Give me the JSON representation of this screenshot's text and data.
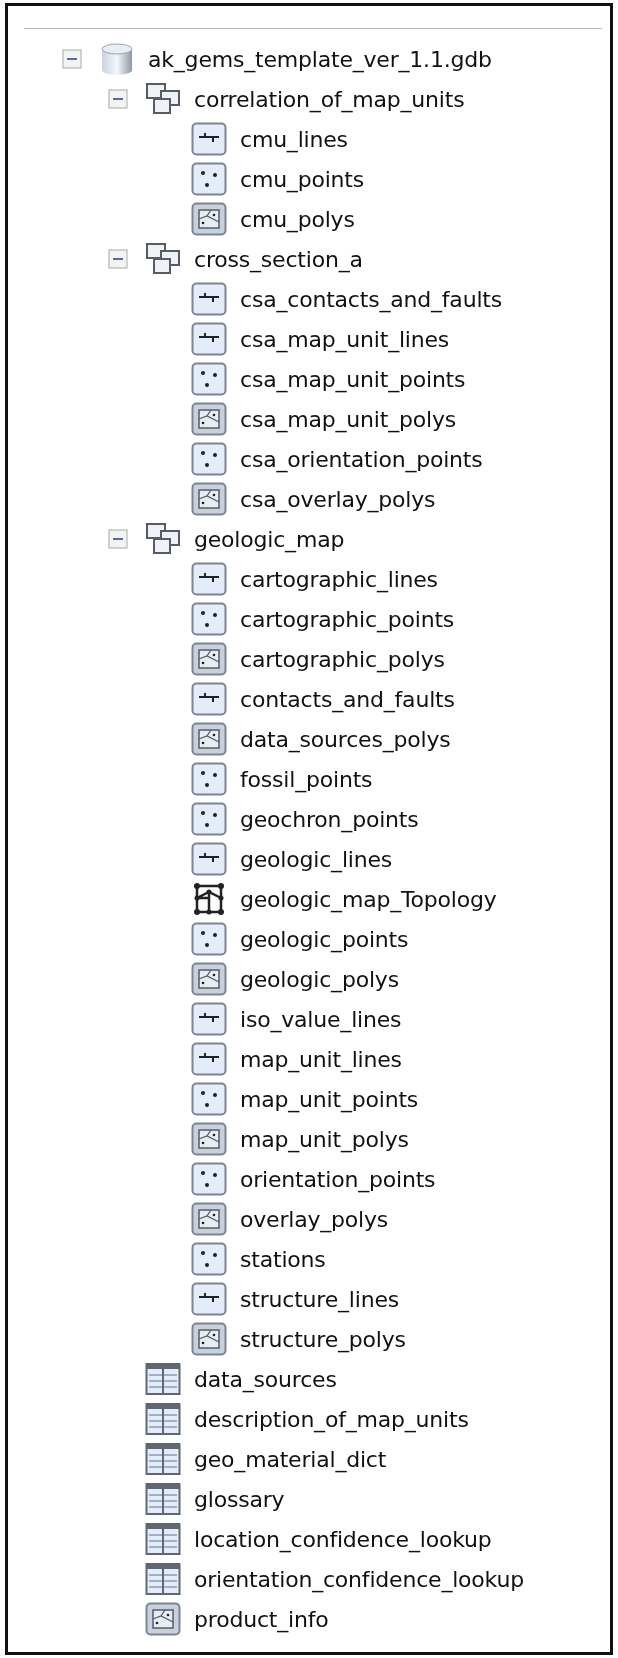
{
  "tree": [
    {
      "label": "ak_gems_template_ver_1.1.gdb",
      "kind": "database",
      "expanded": true,
      "children": [
        {
          "label": "correlation_of_map_units",
          "kind": "dataset",
          "expanded": true,
          "children": [
            {
              "label": "cmu_lines",
              "kind": "line"
            },
            {
              "label": "cmu_points",
              "kind": "point"
            },
            {
              "label": "cmu_polys",
              "kind": "polygon"
            }
          ]
        },
        {
          "label": "cross_section_a",
          "kind": "dataset",
          "expanded": true,
          "children": [
            {
              "label": "csa_contacts_and_faults",
              "kind": "line"
            },
            {
              "label": "csa_map_unit_lines",
              "kind": "line"
            },
            {
              "label": "csa_map_unit_points",
              "kind": "point"
            },
            {
              "label": "csa_map_unit_polys",
              "kind": "polygon"
            },
            {
              "label": "csa_orientation_points",
              "kind": "point"
            },
            {
              "label": "csa_overlay_polys",
              "kind": "polygon"
            }
          ]
        },
        {
          "label": "geologic_map",
          "kind": "dataset",
          "expanded": true,
          "children": [
            {
              "label": "cartographic_lines",
              "kind": "line"
            },
            {
              "label": "cartographic_points",
              "kind": "point"
            },
            {
              "label": "cartographic_polys",
              "kind": "polygon"
            },
            {
              "label": "contacts_and_faults",
              "kind": "line"
            },
            {
              "label": "data_sources_polys",
              "kind": "polygon"
            },
            {
              "label": "fossil_points",
              "kind": "point"
            },
            {
              "label": "geochron_points",
              "kind": "point"
            },
            {
              "label": "geologic_lines",
              "kind": "line"
            },
            {
              "label": "geologic_map_Topology",
              "kind": "topology"
            },
            {
              "label": "geologic_points",
              "kind": "point"
            },
            {
              "label": "geologic_polys",
              "kind": "polygon"
            },
            {
              "label": "iso_value_lines",
              "kind": "line"
            },
            {
              "label": "map_unit_lines",
              "kind": "line"
            },
            {
              "label": "map_unit_points",
              "kind": "point"
            },
            {
              "label": "map_unit_polys",
              "kind": "polygon"
            },
            {
              "label": "orientation_points",
              "kind": "point"
            },
            {
              "label": "overlay_polys",
              "kind": "polygon"
            },
            {
              "label": "stations",
              "kind": "point"
            },
            {
              "label": "structure_lines",
              "kind": "line"
            },
            {
              "label": "structure_polys",
              "kind": "polygon"
            }
          ]
        },
        {
          "label": "data_sources",
          "kind": "table"
        },
        {
          "label": "description_of_map_units",
          "kind": "table"
        },
        {
          "label": "geo_material_dict",
          "kind": "table"
        },
        {
          "label": "glossary",
          "kind": "table"
        },
        {
          "label": "location_confidence_lookup",
          "kind": "table"
        },
        {
          "label": "orientation_confidence_lookup",
          "kind": "table"
        },
        {
          "label": "product_info",
          "kind": "polygon"
        }
      ]
    }
  ]
}
